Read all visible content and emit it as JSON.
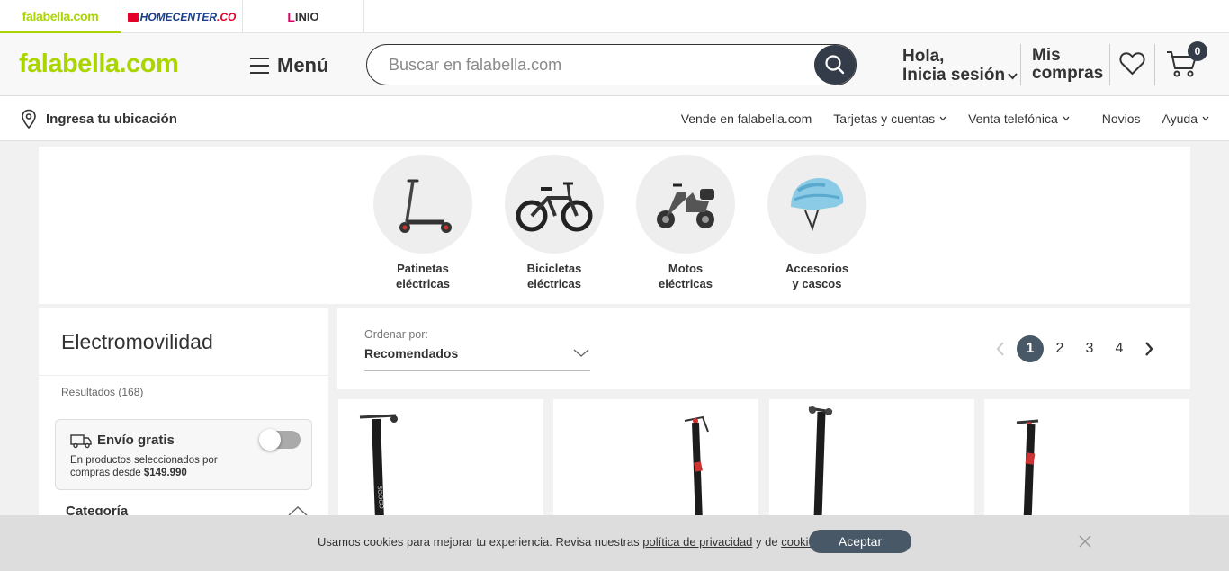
{
  "brands": [
    {
      "label": "falabella.com"
    },
    {
      "label_main": "HOMECENTER",
      "label_suffix": ".CO"
    },
    {
      "label": "INIO",
      "mark": "L"
    }
  ],
  "header": {
    "logo": "falabella.com",
    "menu_label": "Menú",
    "search_placeholder": "Buscar en falabella.com",
    "greeting_line1": "Hola,",
    "greeting_line2": "Inicia sesión",
    "purchases_line1": "Mis",
    "purchases_line2": "compras",
    "cart_count": "0"
  },
  "navbar": {
    "location": "Ingresa tu ubicación",
    "links": [
      {
        "label": "Vende en falabella.com"
      },
      {
        "label": "Tarjetas y cuentas"
      },
      {
        "label": "Venta telefónica"
      },
      {
        "label": "Novios"
      },
      {
        "label": "Ayuda"
      }
    ]
  },
  "categories": [
    {
      "line1": "Patinetas",
      "line2": "eléctricas"
    },
    {
      "line1": "Bicicletas",
      "line2": "eléctricas"
    },
    {
      "line1": "Motos",
      "line2": "eléctricas"
    },
    {
      "line1": "Accesorios",
      "line2": "y cascos"
    }
  ],
  "sidebar": {
    "title": "Electromovilidad",
    "results": "Resultados (168)",
    "free_shipping": {
      "title": "Envío gratis",
      "desc": "En productos seleccionados por compras desde",
      "amount": "$149.990"
    },
    "category_heading": "Categoría"
  },
  "sort": {
    "label": "Ordenar por:",
    "value": "Recomendados"
  },
  "pagination": {
    "pages": [
      "1",
      "2",
      "3",
      "4"
    ],
    "current": "1"
  },
  "cookie": {
    "text_before": "Usamos cookies para mejorar tu experiencia. Revisa nuestras ",
    "link1": "política de privacidad",
    "text_mid": " y de ",
    "link2": "cookies",
    "text_end": ".",
    "accept": "Aceptar"
  },
  "colors": {
    "brand_green": "#aad500",
    "dark_button": "#333c48",
    "pager_active": "#495867"
  }
}
